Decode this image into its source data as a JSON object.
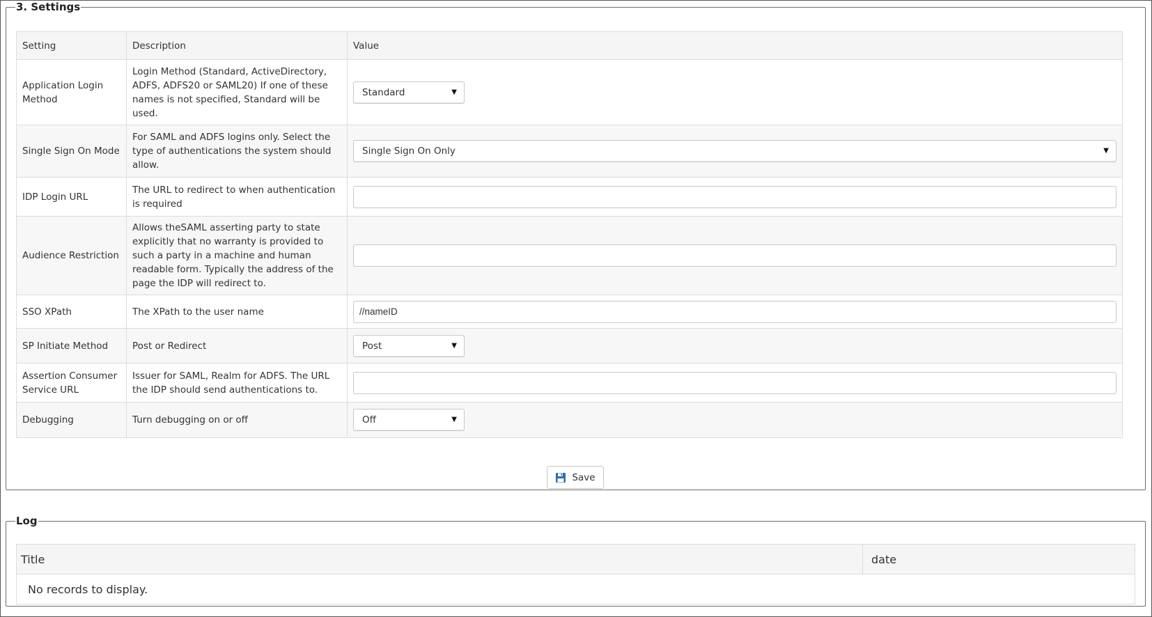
{
  "settings_section": {
    "legend": "3. Settings",
    "columns": {
      "setting": "Setting",
      "description": "Description",
      "value": "Value"
    },
    "rows": [
      {
        "setting": "Application Login Method",
        "description": "Login Method (Standard, ActiveDirectory, ADFS, ADFS20 or SAML20) If one of these names is not specified, Standard will be used.",
        "value": "Standard"
      },
      {
        "setting": "Single Sign On Mode",
        "description": "For SAML and ADFS logins only. Select the type of authentications the system should allow.",
        "value": "Single Sign On Only"
      },
      {
        "setting": "IDP Login URL",
        "description": "The URL to redirect to when authentication is required",
        "value": ""
      },
      {
        "setting": "Audience Restriction",
        "description": "Allows theSAML asserting party to state explicitly that no warranty is provided to such a party in a machine and human readable form. Typically the address of the page the IDP will redirect to.",
        "value": ""
      },
      {
        "setting": "SSO XPath",
        "description": "The XPath to the user name",
        "value": "//nameID"
      },
      {
        "setting": "SP Initiate Method",
        "description": "Post or Redirect",
        "value": "Post"
      },
      {
        "setting": "Assertion Consumer Service URL",
        "description": "Issuer for SAML, Realm for ADFS. The URL the IDP should send authentications to.",
        "value": ""
      },
      {
        "setting": "Debugging",
        "description": "Turn debugging on or off",
        "value": "Off"
      }
    ],
    "save_label": "Save",
    "select_arrow": "▼",
    "save_icon": "floppy-disk-icon"
  },
  "log_section": {
    "legend": "Log",
    "columns": {
      "title": "Title",
      "date": "date"
    },
    "empty_message": "No records to display."
  },
  "colors": {
    "border": "#6e6e6e",
    "header_bg": "#f5f5f5",
    "alt_row_bg": "#f7f7f7",
    "save_icon": "#2e6da4"
  }
}
